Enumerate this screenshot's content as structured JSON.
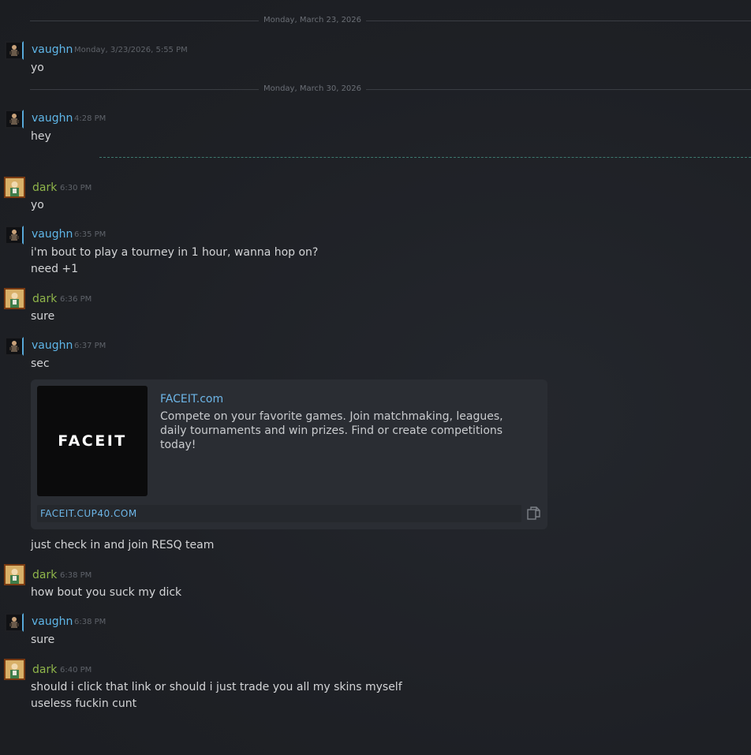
{
  "dividers": [
    {
      "label": "Monday, March 23, 2026"
    },
    {
      "label": "Monday, March 30, 2026"
    }
  ],
  "messages": [
    {
      "user": "vaughn",
      "time": "Monday, 3/23/2026, 5:55 PM",
      "lines": [
        "yo"
      ]
    },
    {
      "user": "vaughn",
      "time": "4:28 PM",
      "lines": [
        "hey"
      ]
    },
    {
      "user": "dark",
      "time": "6:30 PM",
      "lines": [
        "yo"
      ]
    },
    {
      "user": "vaughn",
      "time": "6:35 PM",
      "lines": [
        "i'm bout to play a tourney in 1 hour, wanna hop on?",
        "need +1"
      ]
    },
    {
      "user": "dark",
      "time": "6:36 PM",
      "lines": [
        "sure"
      ]
    },
    {
      "user": "vaughn",
      "time": "6:37 PM",
      "lines": [
        "sec",
        "just check in and join RESQ team"
      ]
    },
    {
      "user": "dark",
      "time": "6:38 PM",
      "lines": [
        "how bout you suck my dick"
      ]
    },
    {
      "user": "vaughn",
      "time": "6:38 PM",
      "lines": [
        "sure"
      ]
    },
    {
      "user": "dark",
      "time": "6:40 PM",
      "lines": [
        "should i click that link or should i just trade you all my skins myself",
        "useless fuckin cunt"
      ]
    }
  ],
  "embed": {
    "logo_text": "FACEIT",
    "title": "FACEIT.com",
    "description": "Compete on your favorite games. Join matchmaking, leagues, daily tournaments and win prizes. Find or create competitions today!",
    "url": "FACEIT.CUP40.COM",
    "copy_icon": "copy-icon"
  },
  "colors": {
    "vaughn_name": "#5fb6e8",
    "dark_name": "#8fb54a",
    "new_messages_divider": "#3d7a6f",
    "background": "#1e2025"
  }
}
